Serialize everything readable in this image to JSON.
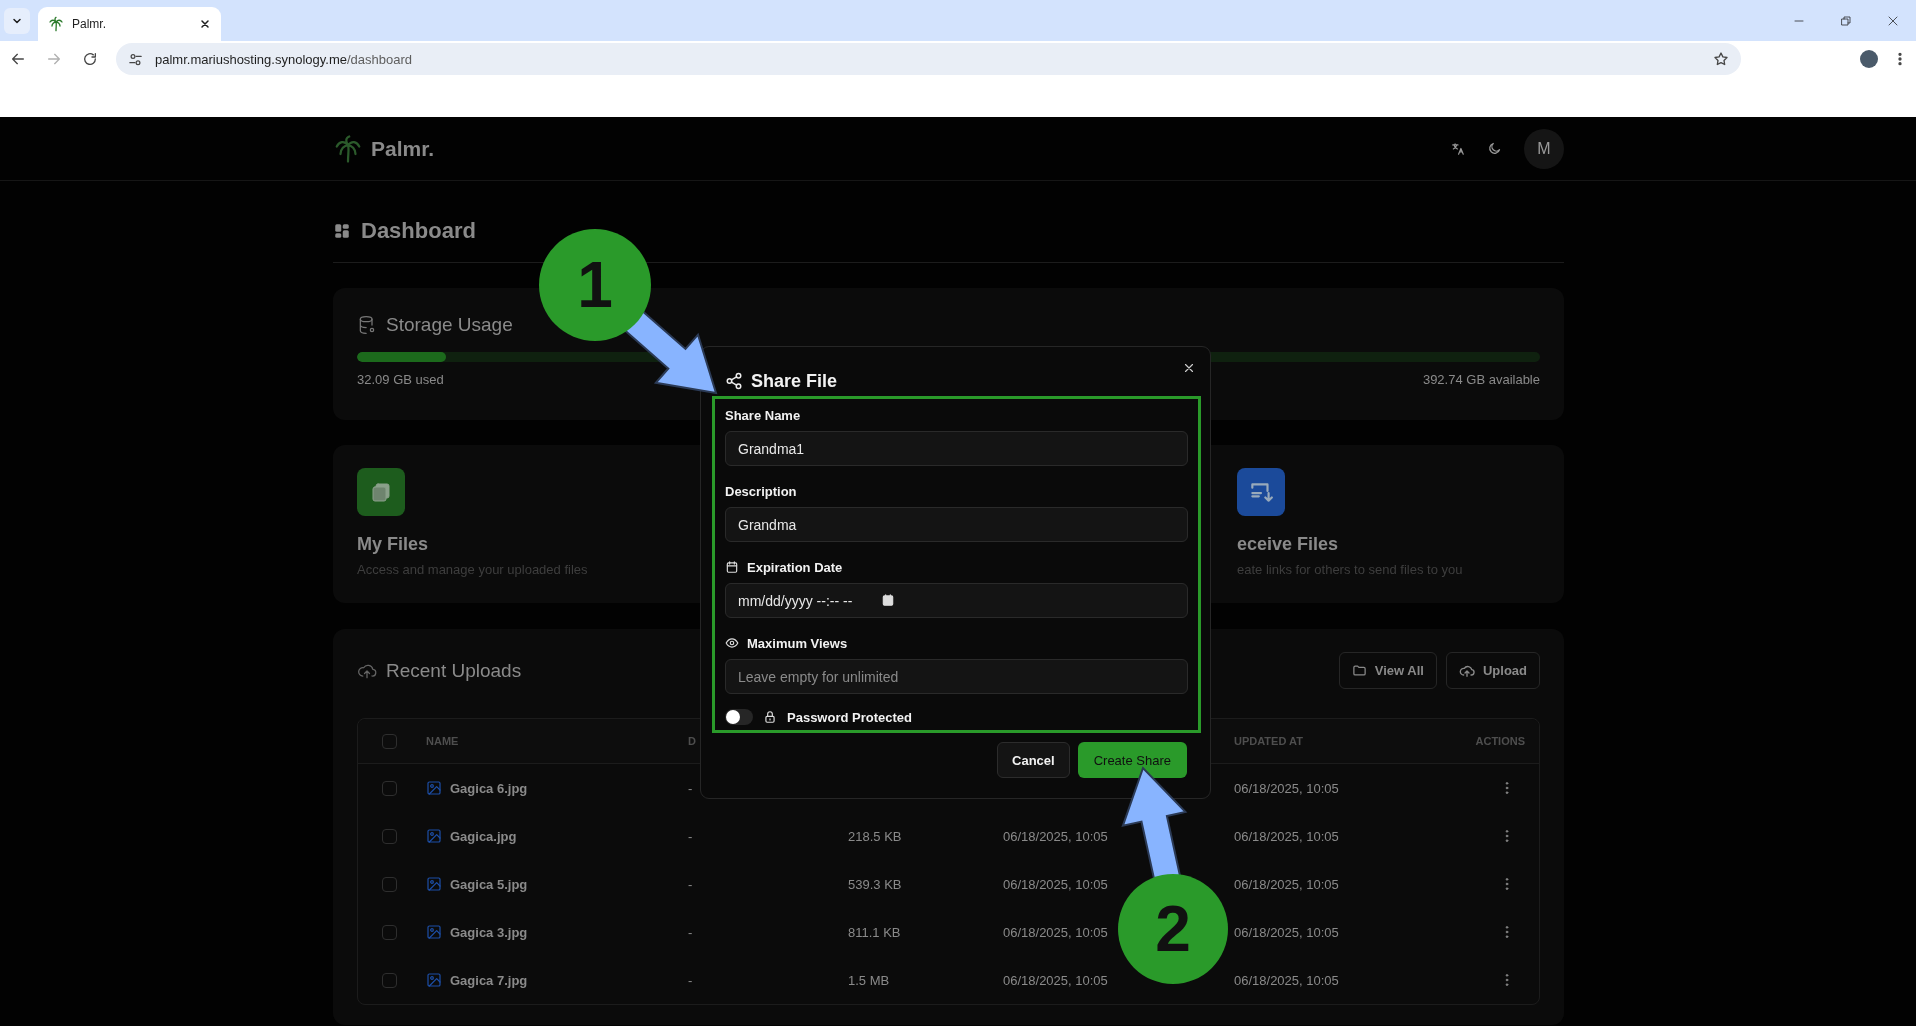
{
  "browser": {
    "tab_title": "Palmr.",
    "url_host": "palmr.mariushosting.synology.me",
    "url_path": "/dashboard"
  },
  "header": {
    "logo": "Palmr.",
    "avatar": "M"
  },
  "dashboard": {
    "title": "Dashboard"
  },
  "storage": {
    "title": "Storage Usage",
    "level": 0.075,
    "used": "32.09 GB used",
    "available": "392.74 GB available"
  },
  "quick_actions": [
    {
      "kind": "files",
      "color": "#1d5c1d",
      "title": "My Files",
      "description": "Access and manage your uploaded files"
    },
    {
      "kind": "receive",
      "color": "#1b4a9a",
      "title": "eceive Files",
      "description": "eate links for others to send files to you"
    }
  ],
  "recent": {
    "title": "Recent Uploads",
    "buttons": [
      {
        "kind": "view_all",
        "label": "View All"
      },
      {
        "kind": "upload",
        "label": "Upload"
      }
    ],
    "table": {
      "select_all": {
        "checked": false
      },
      "columns": [
        "NAME",
        "D",
        "UPDATED AT",
        "ACTIONS"
      ],
      "rows": [
        {
          "checked": false,
          "name": "Gagica 6.jpg",
          "description": "-",
          "updated": "06/18/2025, 10:05"
        },
        {
          "checked": false,
          "name": "Gagica.jpg",
          "description": "-",
          "size": "218.5 KB",
          "created": "06/18/2025, 10:05",
          "updated": "06/18/2025, 10:05"
        },
        {
          "checked": false,
          "name": "Gagica 5.jpg",
          "description": "-",
          "size": "539.3 KB",
          "created": "06/18/2025, 10:05",
          "updated": "06/18/2025, 10:05"
        },
        {
          "checked": false,
          "name": "Gagica 3.jpg",
          "description": "-",
          "size": "811.1 KB",
          "created": "06/18/2025, 10:05",
          "updated": "06/18/2025, 10:05"
        },
        {
          "checked": false,
          "name": "Gagica 7.jpg",
          "description": "-",
          "size": "1.5 MB",
          "created": "06/18/2025, 10:05",
          "updated": "06/18/2025, 10:05"
        }
      ]
    }
  },
  "modal": {
    "title": "Share File",
    "fields": [
      {
        "kind": "text",
        "label": "Share Name",
        "value": "Grandma1"
      },
      {
        "kind": "text",
        "label": "Description",
        "value": "Grandma"
      },
      {
        "kind": "date",
        "label": "Expiration Date",
        "placeholder": "mm/dd/yyyy --:-- --"
      },
      {
        "kind": "number",
        "label": "Maximum Views",
        "placeholder": "Leave empty for unlimited"
      }
    ],
    "toggle": {
      "label": "Password Protected",
      "on": false
    },
    "buttons": [
      {
        "kind": "secondary",
        "label": "Cancel"
      },
      {
        "kind": "primary",
        "label": "Create Share"
      }
    ]
  },
  "annotations": [
    {
      "label": "1"
    },
    {
      "label": "2"
    }
  ]
}
